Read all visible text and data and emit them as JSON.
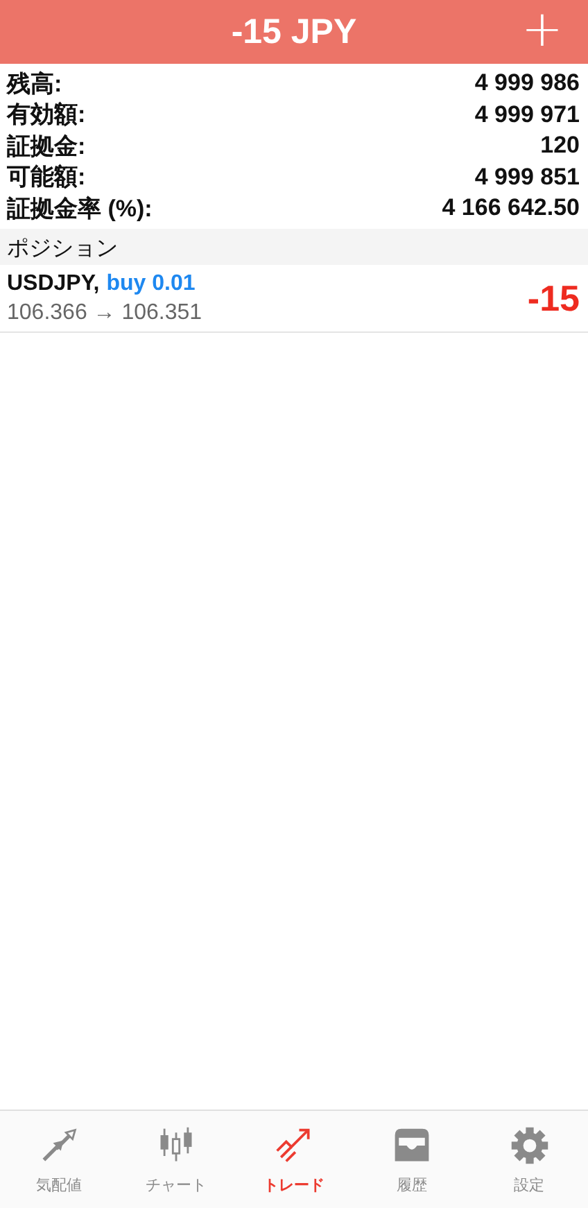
{
  "header": {
    "title": "-15 JPY",
    "add_button": "+"
  },
  "summary": [
    {
      "label": "残高:",
      "value": "4 999 986"
    },
    {
      "label": "有効額:",
      "value": "4 999 971"
    },
    {
      "label": "証拠金:",
      "value": "120"
    },
    {
      "label": "可能額:",
      "value": "4 999 851"
    },
    {
      "label": "証拠金率 (%):",
      "value": "4 166 642.50"
    }
  ],
  "section_title": "ポジション",
  "positions": [
    {
      "symbol": "USDJPY,",
      "order": "buy 0.01",
      "prices": "106.366 → 106.351",
      "profit": "-15"
    }
  ],
  "tabs": [
    {
      "kind": "quotes",
      "label": "気配値",
      "selected": false
    },
    {
      "kind": "chart",
      "label": "チャート",
      "selected": false
    },
    {
      "kind": "trade",
      "label": "トレード",
      "selected": true
    },
    {
      "kind": "history",
      "label": "履歴",
      "selected": false
    },
    {
      "kind": "settings",
      "label": "設定",
      "selected": false
    }
  ]
}
